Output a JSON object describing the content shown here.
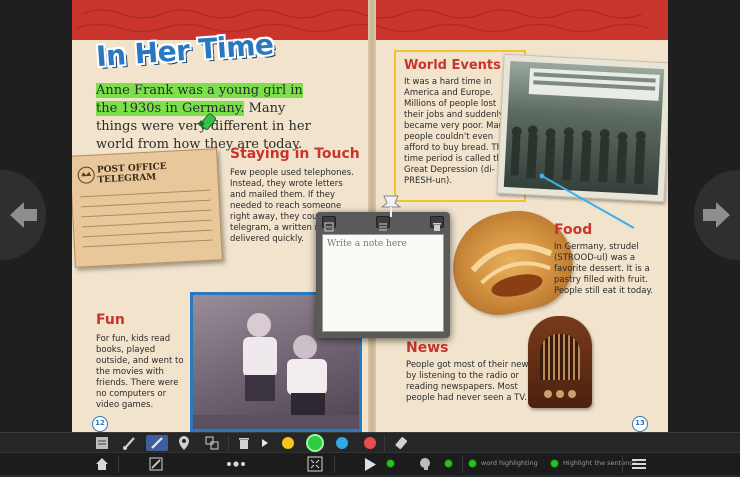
{
  "page_left": {
    "title": "In Her Time",
    "intro_highlighted": "Anne Frank was a young girl in the 1930s in Germany.",
    "intro_rest": " Many things were very different in her world from how they are today.",
    "telegram_header": "POST OFFICE TELEGRAM",
    "staying_in_touch": {
      "heading": "Staying in Touch",
      "body": "Few people used telephones. Instead, they wrote letters and mailed them. If they needed to reach someone right away, they could send a telegram, a written message delivered quickly."
    },
    "fun": {
      "heading": "Fun",
      "body": "For fun, kids read books, played outside, and went to the movies with friends. There were no computers or video games."
    },
    "page_number": "12"
  },
  "page_right": {
    "world_events": {
      "heading": "World Events",
      "body": "It was a hard time in America and Europe. Millions of people lost their jobs and suddenly became very poor. Many people couldn't even afford to buy bread. This time period is called the Great Depression (di-PRESH-un)."
    },
    "food": {
      "heading": "Food",
      "body": "In Germany, strudel (STROOD-ul) was a favorite dessert. It is a pastry filled with fruit. People still eat it today."
    },
    "news": {
      "heading": "News",
      "body": "People got most of their news by listening to the radio or reading newspapers. Most people had never seen a TV."
    },
    "page_number": "13"
  },
  "note_popup": {
    "placeholder": "Write a note here"
  },
  "toolbar": {
    "swatches": [
      "#f5c518",
      "#2ecc40",
      "#2ea8e6",
      "#e84c4c"
    ],
    "selected_swatch": "#2ecc40"
  },
  "bottombar": {
    "word_label": "word",
    "highlighting_label": "highlighting",
    "sentence_label": "Highlight the sentence"
  },
  "colors": {
    "banner": "#c9352c",
    "title_blue": "#2a78c2",
    "highlight": "#7be04b",
    "heading_red": "#c9352c",
    "world_border": "#f2c230"
  }
}
